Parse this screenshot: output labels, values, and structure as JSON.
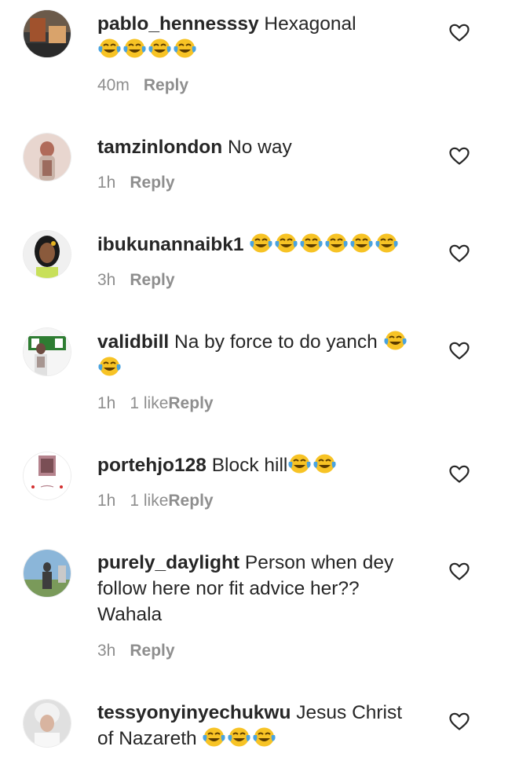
{
  "comments": [
    {
      "username": "pablo_hennesssy",
      "text": "Hexagonal",
      "emoji_count": 4,
      "time": "40m",
      "likes": "",
      "reply_label": "Reply",
      "avatar_icon": "avatar-photo-icon",
      "avatar_colors": [
        "#3a3a3a",
        "#a0522d",
        "#d9a36b"
      ]
    },
    {
      "username": "tamzinlondon",
      "text": "No way",
      "emoji_count": 0,
      "time": "1h",
      "likes": "",
      "reply_label": "Reply",
      "avatar_icon": "avatar-photo-icon",
      "avatar_colors": [
        "#c9b3a8",
        "#b06b5a",
        "#e8d6cf"
      ]
    },
    {
      "username": "ibukunannaibk1",
      "text": "",
      "emoji_count": 6,
      "time": "3h",
      "likes": "",
      "reply_label": "Reply",
      "avatar_icon": "avatar-photo-icon",
      "avatar_colors": [
        "#1a1a1a",
        "#e6b422",
        "#c8e05a"
      ]
    },
    {
      "username": "validbill",
      "text": "Na by force to do yanch",
      "emoji_count": 2,
      "time": "1h",
      "likes": "1 like",
      "reply_label": "Reply",
      "avatar_icon": "avatar-photo-icon",
      "avatar_colors": [
        "#2e7d32",
        "#f5f5f5",
        "#6d4c41"
      ]
    },
    {
      "username": "portehjo128",
      "text": "Block hill",
      "emoji_count": 2,
      "time": "1h",
      "likes": "1 like",
      "reply_label": "Reply",
      "avatar_icon": "avatar-photo-icon",
      "avatar_colors": [
        "#ffffff",
        "#b5838d",
        "#d32f2f"
      ]
    },
    {
      "username": "purely_daylight",
      "text": "Person when dey follow here nor fit advice her?? Wahala",
      "emoji_count": 0,
      "time": "3h",
      "likes": "",
      "reply_label": "Reply",
      "avatar_icon": "avatar-photo-icon",
      "avatar_colors": [
        "#8bb6d9",
        "#3d3d3d",
        "#7a9a5a"
      ]
    },
    {
      "username": "tessyonyinyechukwu",
      "text": "Jesus Christ of Nazareth",
      "emoji_count": 3,
      "time": "",
      "likes": "",
      "reply_label": "",
      "avatar_icon": "avatar-photo-icon",
      "avatar_colors": [
        "#f2f2f2",
        "#d8b4a0",
        "#e0e0e0"
      ]
    }
  ],
  "icons": {
    "emoji": "face-with-tears-of-joy-icon",
    "like": "heart-outline-icon"
  },
  "colors": {
    "text": "#262626",
    "muted": "#8e8e8e",
    "emoji_face": "#f7c325",
    "emoji_tears": "#4aa3df"
  }
}
